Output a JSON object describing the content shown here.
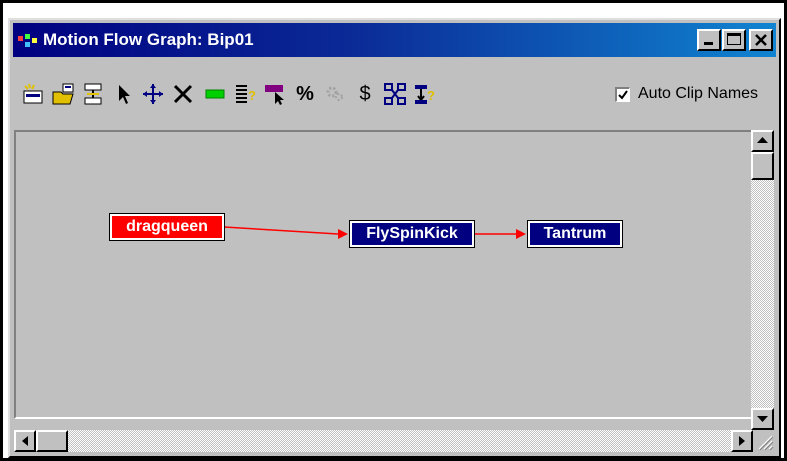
{
  "window": {
    "title": "Motion Flow Graph: Bip01",
    "controls": [
      "minimize",
      "maximize",
      "close"
    ]
  },
  "toolbar": {
    "tools": [
      {
        "name": "create-clip-icon"
      },
      {
        "name": "create-multiple-clips-icon"
      },
      {
        "name": "create-transition-icon"
      },
      {
        "name": "select-icon"
      },
      {
        "name": "move-icon"
      },
      {
        "name": "delete-icon"
      },
      {
        "name": "create-random-start-icon"
      },
      {
        "name": "edit-clip-icon"
      },
      {
        "name": "select-random-start-icon"
      },
      {
        "name": "percentage-icon"
      },
      {
        "name": "optimize-icon"
      },
      {
        "name": "create-unified-motion-icon"
      },
      {
        "name": "zoom-extents-icon"
      },
      {
        "name": "show-transition-icon"
      }
    ],
    "percent_glyph": "%",
    "dollar_glyph": "$",
    "auto_clip_names": {
      "label": "Auto Clip Names",
      "checked": true
    }
  },
  "graph": {
    "nodes": [
      {
        "id": "dragqueen",
        "label": "dragqueen",
        "color": "#ff0000"
      },
      {
        "id": "flyspinkick",
        "label": "FlySpinKick",
        "color": "#000080"
      },
      {
        "id": "tantrum",
        "label": "Tantrum",
        "color": "#000080"
      }
    ],
    "edges": [
      {
        "from": "dragqueen",
        "to": "flyspinkick"
      },
      {
        "from": "flyspinkick",
        "to": "tantrum"
      }
    ],
    "edge_color": "#ff0000"
  }
}
